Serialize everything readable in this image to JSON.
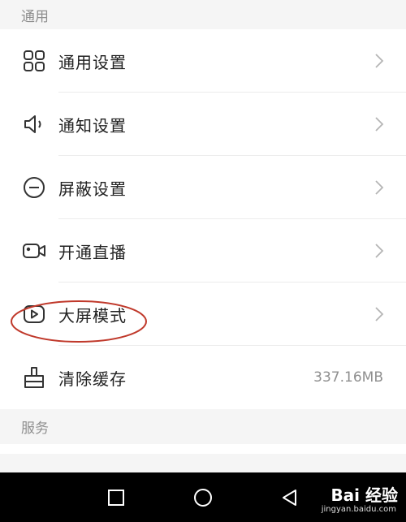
{
  "general_section": {
    "title": "通用",
    "items": [
      {
        "label": "通用设置",
        "icon": "grid-icon"
      },
      {
        "label": "通知设置",
        "icon": "speaker-icon"
      },
      {
        "label": "屏蔽设置",
        "icon": "minus-circle-icon"
      },
      {
        "label": "开通直播",
        "icon": "video-camera-icon"
      },
      {
        "label": "大屏模式",
        "icon": "play-screen-icon"
      },
      {
        "label": "清除缓存",
        "icon": "broom-icon",
        "value": "337.16MB"
      }
    ]
  },
  "services_section": {
    "title": "服务"
  },
  "annotation": {
    "color": "#c0392b",
    "target": "大屏模式"
  },
  "navbar": {
    "buttons": [
      "recent-apps",
      "home",
      "back"
    ]
  },
  "watermark": {
    "logo": "Bai 经验",
    "url": "jingyan.baidu.com"
  },
  "colors": {
    "background": "#f5f5f5",
    "row_background": "#ffffff",
    "label": "#222222",
    "secondary": "#8f8f8f",
    "navbar": "#000000"
  }
}
